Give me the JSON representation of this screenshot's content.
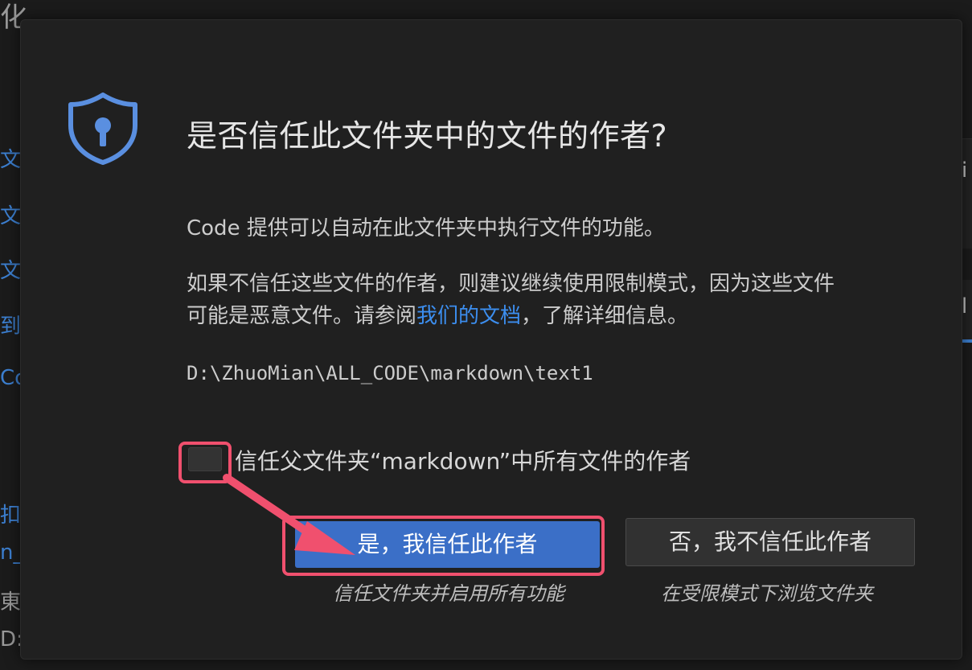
{
  "background": {
    "fragments": [
      {
        "text": "化",
        "gray": true
      },
      {
        "text": "文",
        "gray": false
      },
      {
        "text": "文",
        "gray": false
      },
      {
        "text": "文",
        "gray": false
      },
      {
        "text": "到",
        "gray": false
      },
      {
        "text": "Co",
        "gray": false
      },
      {
        "text": "扣",
        "gray": false
      },
      {
        "text": "n_l",
        "gray": false
      },
      {
        "text": "東面",
        "gray": true
      },
      {
        "text": "D:\\",
        "gray": true
      }
    ],
    "right_frag_1": "i",
    "right_frag_2": "l"
  },
  "dialog": {
    "title": "是否信任此文件夹中的文件的作者?",
    "paragraph1": "Code 提供可以自动在此文件夹中执行文件的功能。",
    "paragraph2_line1": "如果不信任这些文件的作者，则建议继续使用限制模式，因为这些文件",
    "paragraph2_line2_before": "可能是恶意文件。请参阅",
    "paragraph2_link": "我们的文档",
    "paragraph2_line2_after": "，了解详细信息。",
    "folder_path": "D:\\ZhuoMian\\ALL_CODE\\markdown\\text1",
    "checkbox_label": "信任父文件夹“markdown”中所有文件的作者",
    "checkbox_checked": false,
    "yes_button": "是，我信任此作者",
    "yes_hint": "信任文件夹并启用所有功能",
    "no_button": "否，我不信任此作者",
    "no_hint": "在受限模式下浏览文件夹"
  },
  "colors": {
    "accent": "#3b6fc7",
    "link": "#3c8eef",
    "annotation": "#f0506e",
    "shield": "#5a8fe0"
  }
}
